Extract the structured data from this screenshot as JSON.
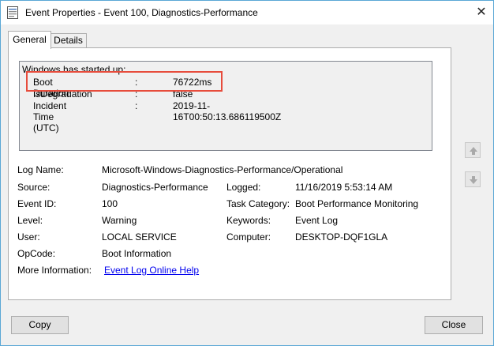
{
  "window": {
    "title": "Event Properties - Event 100, Diagnostics-Performance",
    "close_glyph": "✕"
  },
  "tabs": [
    {
      "label": "General",
      "selected": true
    },
    {
      "label": "Details",
      "selected": false
    }
  ],
  "description": {
    "heading": "Windows has started up:",
    "rows": [
      {
        "key": "Boot Duration",
        "sep": ":",
        "value": "76722ms",
        "highlighted": true
      },
      {
        "key": "IsDegradation",
        "sep": ":",
        "value": "false",
        "highlighted": false
      },
      {
        "key": "Incident Time (UTC)",
        "sep": ":",
        "value": "2019-11-16T00:50:13.686119500Z",
        "highlighted": false
      }
    ],
    "highlight_color": "#e74c3c"
  },
  "fields": {
    "log_name": {
      "label": "Log Name:",
      "value": "Microsoft-Windows-Diagnostics-Performance/Operational"
    },
    "source": {
      "label": "Source:",
      "value": "Diagnostics-Performance"
    },
    "logged": {
      "label": "Logged:",
      "value": "11/16/2019 5:53:14 AM"
    },
    "event_id": {
      "label": "Event ID:",
      "value": "100"
    },
    "task_category": {
      "label": "Task Category:",
      "value": "Boot Performance Monitoring"
    },
    "level": {
      "label": "Level:",
      "value": "Warning"
    },
    "keywords": {
      "label": "Keywords:",
      "value": "Event Log"
    },
    "user": {
      "label": "User:",
      "value": "LOCAL SERVICE"
    },
    "computer": {
      "label": "Computer:",
      "value": "DESKTOP-DQF1GLA"
    },
    "opcode": {
      "label": "OpCode:",
      "value": "Boot Information"
    },
    "more_info": {
      "label": "More Information:",
      "value": "Event Log Online Help"
    }
  },
  "nav": {
    "up_icon": "arrow-up-icon",
    "down_icon": "arrow-down-icon"
  },
  "buttons": {
    "copy": "Copy",
    "close": "Close"
  },
  "colors": {
    "link": "#0000ee",
    "window_border": "#5aa7d6"
  }
}
